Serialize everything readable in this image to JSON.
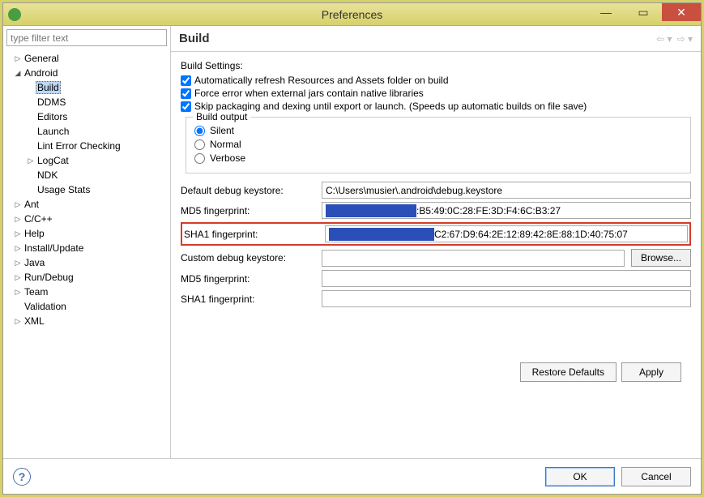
{
  "title": "Preferences",
  "filter_placeholder": "type filter text",
  "tree": {
    "general": "General",
    "android": "Android",
    "build": "Build",
    "ddms": "DDMS",
    "editors": "Editors",
    "launch": "Launch",
    "lint": "Lint Error Checking",
    "logcat": "LogCat",
    "ndk": "NDK",
    "usage": "Usage Stats",
    "ant": "Ant",
    "cpp": "C/C++",
    "help": "Help",
    "install": "Install/Update",
    "java": "Java",
    "rundebug": "Run/Debug",
    "team": "Team",
    "validation": "Validation",
    "xml": "XML"
  },
  "page": {
    "title": "Build",
    "settings_label": "Build Settings:",
    "cb1": "Automatically refresh Resources and Assets folder on build",
    "cb2": "Force error when external jars contain native libraries",
    "cb3": "Skip packaging and dexing until export or launch. (Speeds up automatic builds on file save)",
    "group_title": "Build output",
    "r1": "Silent",
    "r2": "Normal",
    "r3": "Verbose",
    "lbl_default_keystore": "Default debug keystore:",
    "val_default_keystore": "C:\\Users\\musier\\.android\\debug.keystore",
    "lbl_md5": "MD5 fingerprint:",
    "val_md5_tail": ":B5:49:0C:28:FE:3D:F4:6C:B3:27",
    "lbl_sha1": "SHA1 fingerprint:",
    "val_sha1_tail": "C2:67:D9:64:2E:12:89:42:8E:88:1D:40:75:07",
    "lbl_custom_keystore": "Custom debug keystore:",
    "browse": "Browse...",
    "lbl_md5_2": "MD5 fingerprint:",
    "lbl_sha1_2": "SHA1 fingerprint:",
    "restore": "Restore Defaults",
    "apply": "Apply"
  },
  "footer": {
    "ok": "OK",
    "cancel": "Cancel"
  }
}
